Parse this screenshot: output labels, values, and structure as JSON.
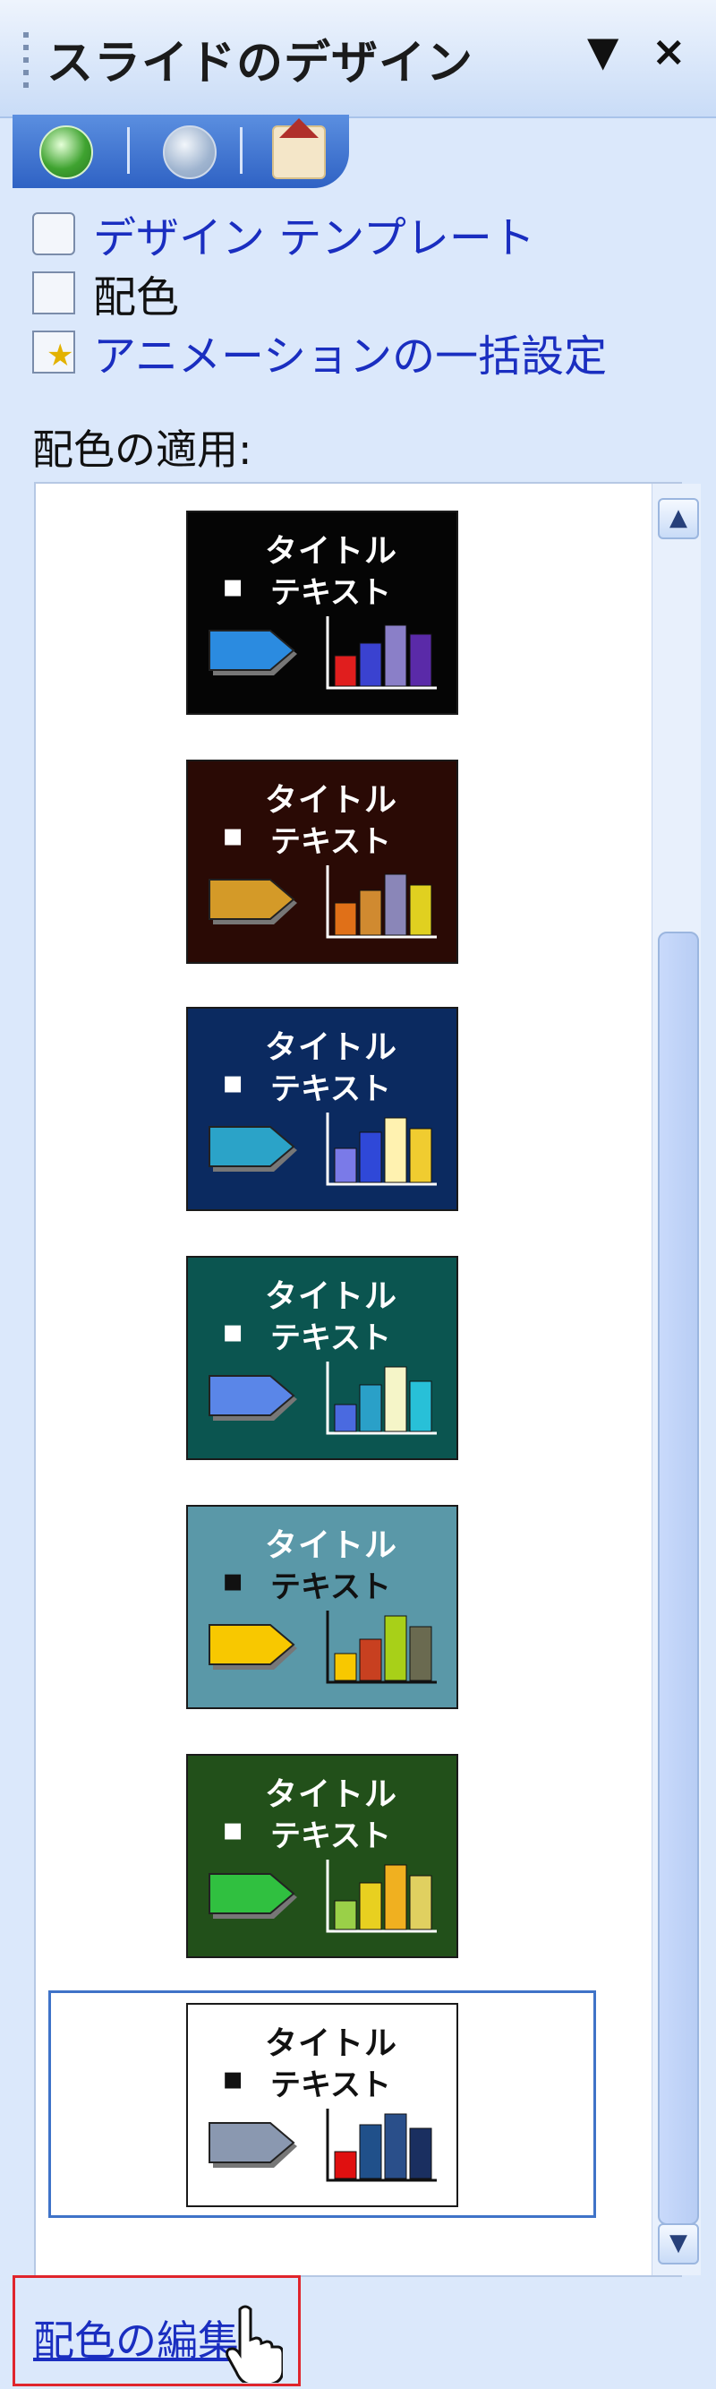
{
  "pane": {
    "title": "スライドのデザイン",
    "dropdown_icon": "▼",
    "close_icon": "×"
  },
  "nav": {
    "back_icon": "back-icon",
    "forward_icon": "forward-icon",
    "home_icon": "home-icon"
  },
  "links": [
    {
      "label": "デザイン テンプレート",
      "icon": "design-template-icon",
      "active": true
    },
    {
      "label": "配色",
      "icon": "color-scheme-icon",
      "active": false
    },
    {
      "label": "アニメーションの一括設定",
      "icon": "animation-scheme-icon",
      "active": true
    }
  ],
  "section_label": "配色の適用:",
  "scroll": {
    "up": "▲",
    "down": "▼"
  },
  "schemes": [
    {
      "title": "タイトル",
      "bullet": "▪",
      "text": "テキスト",
      "bg": "#050505",
      "title_color": "#ffffff",
      "text_color": "#ffffff",
      "arrow": "#2b8be0",
      "bars": [
        "#e01e1e",
        "#3a42d0",
        "#8a7fc8",
        "#5a2aa8"
      ]
    },
    {
      "title": "タイトル",
      "bullet": "▪",
      "text": "テキスト",
      "bg": "#2a0a05",
      "title_color": "#ffffff",
      "text_color": "#ffffff",
      "arrow": "#d49a28",
      "bars": [
        "#e07018",
        "#d08a30",
        "#8a86b8",
        "#e0d020"
      ]
    },
    {
      "title": "タイトル",
      "bullet": "▪",
      "text": "テキスト",
      "bg": "#0b2a60",
      "title_color": "#ffffff",
      "text_color": "#ffffff",
      "arrow": "#2ba3c8",
      "bars": [
        "#7a7ae8",
        "#2f48d8",
        "#fff2b0",
        "#f0cc30"
      ]
    },
    {
      "title": "タイトル",
      "bullet": "▪",
      "text": "テキスト",
      "bg": "#0b5550",
      "title_color": "#ffffff",
      "text_color": "#ffffff",
      "arrow": "#5a86e8",
      "bars": [
        "#4a6ae0",
        "#2aa0c8",
        "#f5f5c8",
        "#28c0d8"
      ]
    },
    {
      "title": "タイトル",
      "bullet": "▪",
      "text": "テキスト",
      "bg": "#5a98a8",
      "title_color": "#ffffff",
      "text_color": "#111111",
      "arrow": "#f8c800",
      "bars": [
        "#f8c800",
        "#c84020",
        "#a8d018",
        "#6a6a50"
      ]
    },
    {
      "title": "タイトル",
      "bullet": "▪",
      "text": "テキスト",
      "bg": "#22501a",
      "title_color": "#ffffff",
      "text_color": "#ffffff",
      "arrow": "#30c040",
      "bars": [
        "#9ad048",
        "#e8d020",
        "#f0b020",
        "#e0d060"
      ]
    },
    {
      "title": "タイトル",
      "bullet": "▪",
      "text": "テキスト",
      "bg": "#ffffff",
      "title_color": "#111111",
      "text_color": "#111111",
      "arrow": "#8a98b0",
      "bars": [
        "#e01010",
        "#20508a",
        "#2a4f8a",
        "#1a2f60"
      ],
      "selected": true
    }
  ],
  "footer_link": "配色の編集",
  "accent_color": "#1a2ec0",
  "highlight_color": "#e0242c"
}
